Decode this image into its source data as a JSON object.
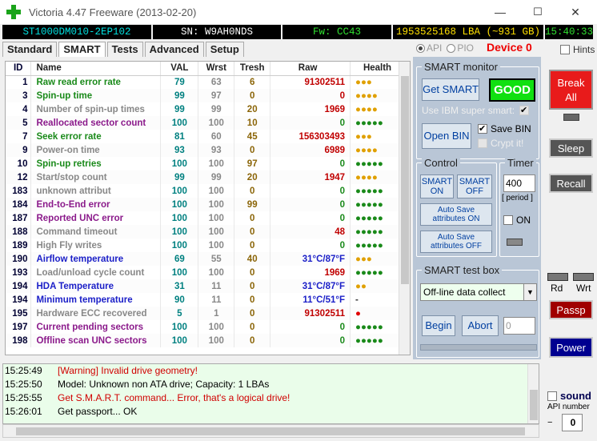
{
  "window": {
    "title": "Victoria 4.47  Freeware (2013-02-20)",
    "min": "—",
    "max": "☐",
    "close": "✕"
  },
  "infobar": {
    "model": "ST1000DM010-2EP102",
    "serial": "SN: W9AH0NDS",
    "firmware": "Fw: CC43",
    "lba": "1953525168 LBA (~931 GB)",
    "time": "15:40:33"
  },
  "tabs": [
    "Standard",
    "SMART",
    "Tests",
    "Advanced",
    "Setup"
  ],
  "api_label": "API",
  "pio_label": "PIO",
  "device": "Device 0",
  "hints": "Hints",
  "table": {
    "headers": [
      "ID",
      "Name",
      "VAL",
      "Wrst",
      "Tresh",
      "Raw",
      "Health"
    ],
    "rows": [
      {
        "id": "1",
        "name": "Raw read error rate",
        "val": "79",
        "wrst": "63",
        "tresh": "6",
        "raw": "91302511",
        "health": "●●●",
        "cls": "c-green",
        "rawc": "#c00000",
        "hc": "#e0a000"
      },
      {
        "id": "3",
        "name": "Spin-up time",
        "val": "99",
        "wrst": "97",
        "tresh": "0",
        "raw": "0",
        "health": "●●●●",
        "cls": "c-green",
        "rawc": "#c00000",
        "hc": "#e0a000"
      },
      {
        "id": "4",
        "name": "Number of spin-up times",
        "val": "99",
        "wrst": "99",
        "tresh": "20",
        "raw": "1969",
        "health": "●●●●",
        "cls": "c-gray",
        "rawc": "#c00000",
        "hc": "#e0a000"
      },
      {
        "id": "5",
        "name": "Reallocated sector count",
        "val": "100",
        "wrst": "100",
        "tresh": "10",
        "raw": "0",
        "health": "●●●●●",
        "cls": "c-purple",
        "rawc": "#1a8a1a",
        "hc": "#1a8a1a"
      },
      {
        "id": "7",
        "name": "Seek error rate",
        "val": "81",
        "wrst": "60",
        "tresh": "45",
        "raw": "156303493",
        "health": "●●●",
        "cls": "c-green",
        "rawc": "#c00000",
        "hc": "#e0a000"
      },
      {
        "id": "9",
        "name": "Power-on time",
        "val": "93",
        "wrst": "93",
        "tresh": "0",
        "raw": "6989",
        "health": "●●●●",
        "cls": "c-gray",
        "rawc": "#c00000",
        "hc": "#e0a000"
      },
      {
        "id": "10",
        "name": "Spin-up retries",
        "val": "100",
        "wrst": "100",
        "tresh": "97",
        "raw": "0",
        "health": "●●●●●",
        "cls": "c-green",
        "rawc": "#1a8a1a",
        "hc": "#1a8a1a"
      },
      {
        "id": "12",
        "name": "Start/stop count",
        "val": "99",
        "wrst": "99",
        "tresh": "20",
        "raw": "1947",
        "health": "●●●●",
        "cls": "c-gray",
        "rawc": "#c00000",
        "hc": "#e0a000"
      },
      {
        "id": "183",
        "name": "unknown attribut",
        "val": "100",
        "wrst": "100",
        "tresh": "0",
        "raw": "0",
        "health": "●●●●●",
        "cls": "c-gray",
        "rawc": "#1a8a1a",
        "hc": "#1a8a1a"
      },
      {
        "id": "184",
        "name": "End-to-End error",
        "val": "100",
        "wrst": "100",
        "tresh": "99",
        "raw": "0",
        "health": "●●●●●",
        "cls": "c-purple",
        "rawc": "#1a8a1a",
        "hc": "#1a8a1a"
      },
      {
        "id": "187",
        "name": "Reported UNC error",
        "val": "100",
        "wrst": "100",
        "tresh": "0",
        "raw": "0",
        "health": "●●●●●",
        "cls": "c-purple",
        "rawc": "#1a8a1a",
        "hc": "#1a8a1a"
      },
      {
        "id": "188",
        "name": "Command timeout",
        "val": "100",
        "wrst": "100",
        "tresh": "0",
        "raw": "48",
        "health": "●●●●●",
        "cls": "c-gray",
        "rawc": "#c00000",
        "hc": "#1a8a1a"
      },
      {
        "id": "189",
        "name": "High Fly writes",
        "val": "100",
        "wrst": "100",
        "tresh": "0",
        "raw": "0",
        "health": "●●●●●",
        "cls": "c-gray",
        "rawc": "#1a8a1a",
        "hc": "#1a8a1a"
      },
      {
        "id": "190",
        "name": "Airflow temperature",
        "val": "69",
        "wrst": "55",
        "tresh": "40",
        "raw": "31°C/87°F",
        "health": "●●●",
        "cls": "c-blue",
        "rawc": "#1c20c8",
        "hc": "#e0a000"
      },
      {
        "id": "193",
        "name": "Load/unload cycle count",
        "val": "100",
        "wrst": "100",
        "tresh": "0",
        "raw": "1969",
        "health": "●●●●●",
        "cls": "c-gray",
        "rawc": "#c00000",
        "hc": "#1a8a1a"
      },
      {
        "id": "194",
        "name": "HDA Temperature",
        "val": "31",
        "wrst": "11",
        "tresh": "0",
        "raw": "31°C/87°F",
        "health": "●●",
        "cls": "c-blue",
        "rawc": "#1c20c8",
        "hc": "#e0a000"
      },
      {
        "id": "194",
        "name": "Minimum temperature",
        "val": "90",
        "wrst": "11",
        "tresh": "0",
        "raw": "11°C/51°F",
        "health": "-",
        "cls": "c-blue",
        "rawc": "#1c20c8",
        "hc": "#333"
      },
      {
        "id": "195",
        "name": "Hardware ECC recovered",
        "val": "5",
        "wrst": "1",
        "tresh": "0",
        "raw": "91302511",
        "health": "●",
        "cls": "c-gray",
        "rawc": "#c00000",
        "hc": "#e00000"
      },
      {
        "id": "197",
        "name": "Current pending sectors",
        "val": "100",
        "wrst": "100",
        "tresh": "0",
        "raw": "0",
        "health": "●●●●●",
        "cls": "c-purple",
        "rawc": "#1a8a1a",
        "hc": "#1a8a1a"
      },
      {
        "id": "198",
        "name": "Offline scan UNC sectors",
        "val": "100",
        "wrst": "100",
        "tresh": "0",
        "raw": "0",
        "health": "●●●●●",
        "cls": "c-purple",
        "rawc": "#1a8a1a",
        "hc": "#1a8a1a"
      }
    ]
  },
  "log": [
    {
      "time": "15:25:49",
      "msg": "[Warning] Invalid drive geometry!",
      "color": "#d00000"
    },
    {
      "time": "15:25:50",
      "msg": "Model: Unknown non ATA drive; Capacity: 1 LBAs",
      "color": "#000"
    },
    {
      "time": "15:25:55",
      "msg": "Get S.M.A.R.T. command... Error, that's a logical drive!",
      "color": "#d00000"
    },
    {
      "time": "15:26:01",
      "msg": "Get passport... OK",
      "color": "#000"
    }
  ],
  "smart_monitor": {
    "label": "SMART monitor",
    "get_smart": "Get SMART",
    "status": "GOOD",
    "ibm": "Use IBM super smart:",
    "open_bin": "Open BIN",
    "save_bin": "Save BIN",
    "crypt": "Crypt it!"
  },
  "control": {
    "label": "Control",
    "smart_on": "SMART ON",
    "smart_off": "SMART OFF",
    "autosave_on": "Auto Save attributes ON",
    "autosave_off": "Auto Save attributes OFF"
  },
  "timer": {
    "label": "Timer",
    "value": "400",
    "period": "[ period ]",
    "on": "ON"
  },
  "test_box": {
    "label": "SMART test box",
    "selected": "Off-line data collect",
    "begin": "Begin",
    "abort": "Abort",
    "count": "0"
  },
  "side": {
    "break": "Break All",
    "sleep": "Sleep",
    "recall": "Recall",
    "rd": "Rd",
    "wrt": "Wrt",
    "passp": "Passp",
    "power": "Power",
    "sound": "sound",
    "api_number": "API number",
    "api_value": "0"
  }
}
